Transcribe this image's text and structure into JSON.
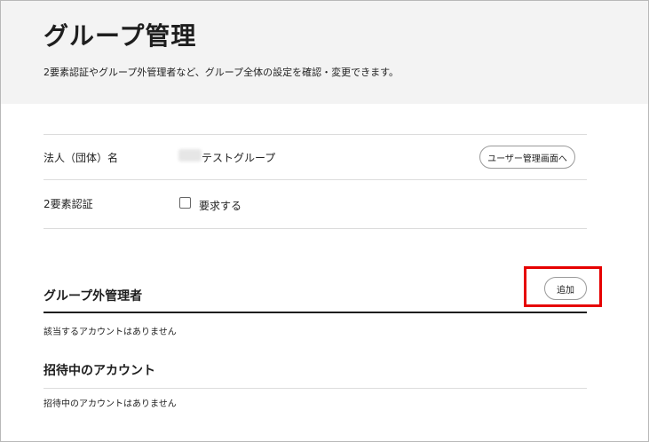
{
  "header": {
    "title": "グループ管理",
    "description": "2要素認証やグループ外管理者など、グループ全体の設定を確認・変更できます。"
  },
  "settings": {
    "org_name_label": "法人（団体）名",
    "org_name_value": "テストグループ",
    "user_mgmt_button": "ユーザー管理画面へ",
    "two_factor_label": "2要素認証",
    "two_factor_option": "要求する",
    "two_factor_checked": false
  },
  "external_admins": {
    "title": "グループ外管理者",
    "add_button": "追加",
    "empty_message": "該当するアカウントはありません"
  },
  "invited_accounts": {
    "title": "招待中のアカウント",
    "empty_message": "招待中のアカウントはありません"
  },
  "colors": {
    "header_bg": "#f3f3f3",
    "highlight": "#e60000"
  }
}
